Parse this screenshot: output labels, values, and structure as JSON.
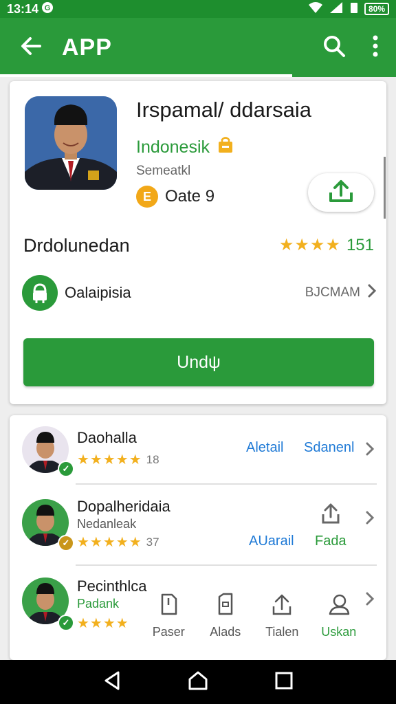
{
  "status_bar": {
    "time": "13:14",
    "battery": "80%"
  },
  "app_bar": {
    "title": "APP"
  },
  "app": {
    "name": "Irspamal/ ddarsaia",
    "developer": "Indonesik",
    "category": "Semeatkl",
    "date": "Oate 9",
    "downloads_label": "Drdolunedan",
    "rating_stars": "★★★★",
    "rating_count": "151",
    "install_label": "Oalaipisia",
    "install_right": "BJCMAM",
    "main_button": "Undψ"
  },
  "list": [
    {
      "name": "Daohalla",
      "sub": "",
      "stars": "★★★★★",
      "count": "18",
      "link1": "Aletail",
      "link2": "Sdanenl",
      "badge": "check"
    },
    {
      "name": "Dopalheridaia",
      "sub": "Nedanleak",
      "stars": "★★★★★",
      "count": "37",
      "link1": "AUarail",
      "link2": "Fada",
      "badge": "check"
    },
    {
      "name": "Pecinthlca",
      "sub": "Padank",
      "stars": "★★★★",
      "count": "",
      "badge": "check"
    }
  ],
  "tabs": [
    {
      "label": "Paser",
      "icon": "phone-icon"
    },
    {
      "label": "Alads",
      "icon": "document-icon"
    },
    {
      "label": "Tialen",
      "icon": "upload-icon"
    },
    {
      "label": "Uskan",
      "icon": "person-icon"
    }
  ],
  "colors": {
    "primary_green": "#2a9a3a",
    "dark_green": "#1e8e2e",
    "star": "#f2b01e",
    "link_blue": "#1f7ad6"
  }
}
